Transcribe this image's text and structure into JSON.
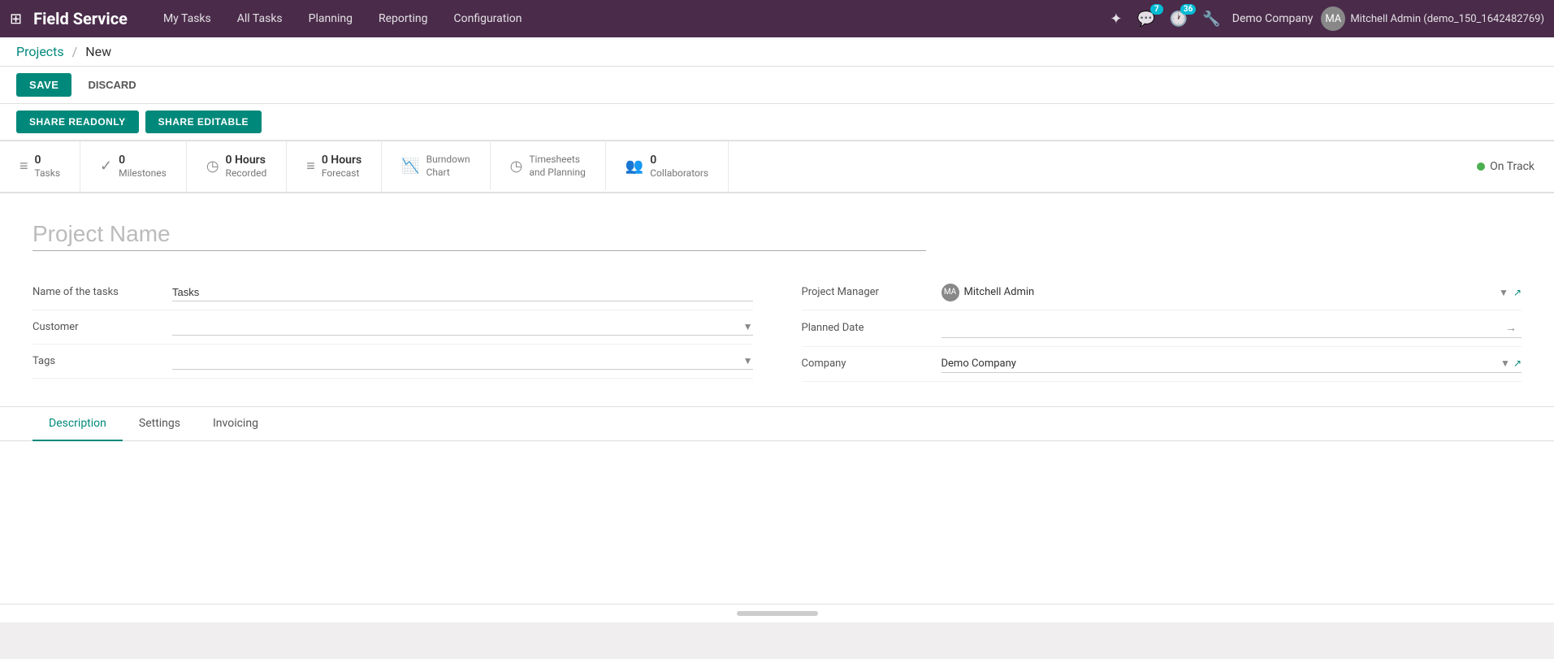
{
  "topbar": {
    "app_title": "Field Service",
    "nav_items": [
      {
        "label": "My Tasks"
      },
      {
        "label": "All Tasks"
      },
      {
        "label": "Planning"
      },
      {
        "label": "Reporting"
      },
      {
        "label": "Configuration"
      }
    ],
    "icons": {
      "settings": "⚙",
      "chat": "💬",
      "chat_badge": "7",
      "clock": "🕐",
      "clock_badge": "36",
      "wrench": "🔧"
    },
    "company": "Demo Company",
    "user": "Mitchell Admin (demo_150_1642482769)"
  },
  "breadcrumb": {
    "parent": "Projects",
    "current": "New"
  },
  "actions": {
    "save_label": "SAVE",
    "discard_label": "DISCARD",
    "share_readonly_label": "SHARE READONLY",
    "share_editable_label": "SHARE EDITABLE"
  },
  "stats": [
    {
      "icon": "≡",
      "num": "0",
      "label": "Tasks"
    },
    {
      "icon": "✓",
      "num": "0",
      "label": "Milestones"
    },
    {
      "icon": "◷",
      "num": "0 Hours",
      "label": "Recorded"
    },
    {
      "icon": "≡",
      "num": "0 Hours",
      "label": "Forecast"
    },
    {
      "icon": "📈",
      "num": "",
      "label": "Burndown Chart"
    },
    {
      "icon": "◷",
      "num": "",
      "label": "Timesheets and Planning"
    },
    {
      "icon": "👥",
      "num": "0",
      "label": "Collaborators"
    }
  ],
  "on_track": {
    "label": "On Track"
  },
  "form": {
    "project_name_placeholder": "Project Name",
    "left_fields": [
      {
        "label": "Name of the tasks",
        "value": "Tasks",
        "type": "input"
      },
      {
        "label": "Customer",
        "value": "",
        "type": "select"
      },
      {
        "label": "Tags",
        "value": "",
        "type": "select"
      }
    ],
    "right_fields": [
      {
        "label": "Project Manager",
        "type": "manager",
        "value": "Mitchell Admin"
      },
      {
        "label": "Planned Date",
        "type": "date",
        "value": ""
      },
      {
        "label": "Company",
        "type": "company",
        "value": "Demo Company"
      }
    ]
  },
  "tabs": [
    {
      "label": "Description",
      "active": true
    },
    {
      "label": "Settings",
      "active": false
    },
    {
      "label": "Invoicing",
      "active": false
    }
  ]
}
